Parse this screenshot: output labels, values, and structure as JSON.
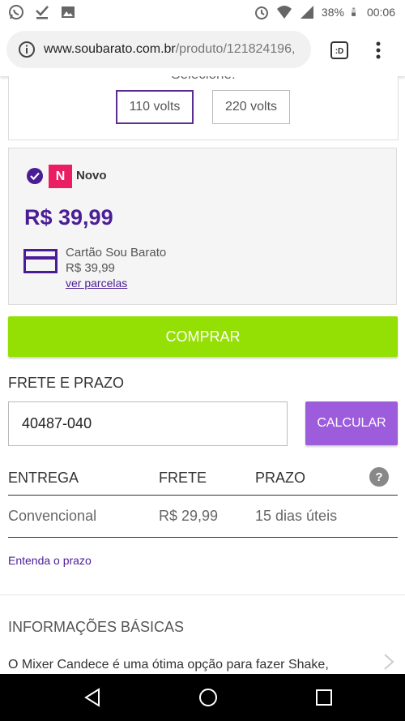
{
  "status_bar": {
    "battery": "38%",
    "time": "00:06",
    "left_icons": [
      "whatsapp-icon",
      "check-download-icon",
      "image-icon"
    ],
    "right_icons": [
      "alarm-icon",
      "wifi-icon",
      "signal-icon",
      "battery-icon"
    ]
  },
  "browser": {
    "url_domain": "www.soubarato.com.br",
    "url_path": "/produto/121824196,"
  },
  "voltage": {
    "label": "Selecione:",
    "options": [
      "110 volts",
      "220 volts"
    ],
    "selected": "110 volts"
  },
  "offer": {
    "badge": "N",
    "condition": "Novo",
    "price": "R$ 39,99",
    "card_name": "Cartão Sou Barato",
    "card_price": "R$ 39,99",
    "installments_link": "ver parcelas"
  },
  "buy_button": "COMPRAR",
  "shipping": {
    "title": "FRETE E PRAZO",
    "cep_value": "40487-040",
    "calc_button": "CALCULAR",
    "headers": [
      "ENTREGA",
      "FRETE",
      "PRAZO"
    ],
    "help": "?",
    "rows": [
      {
        "entrega": "Convencional",
        "frete": "R$ 29,99",
        "prazo": "15 dias úteis"
      }
    ],
    "prazo_link": "Entenda o prazo"
  },
  "info": {
    "title": "INFORMAÇÕES BÁSICAS",
    "text": "O Mixer Candece é uma ótima opção para fazer Shake,"
  },
  "colors": {
    "brand_purple": "#4a1d96",
    "buy_green": "#94e004",
    "calc_purple": "#9c5cdb",
    "badge_pink": "#e91e63"
  }
}
